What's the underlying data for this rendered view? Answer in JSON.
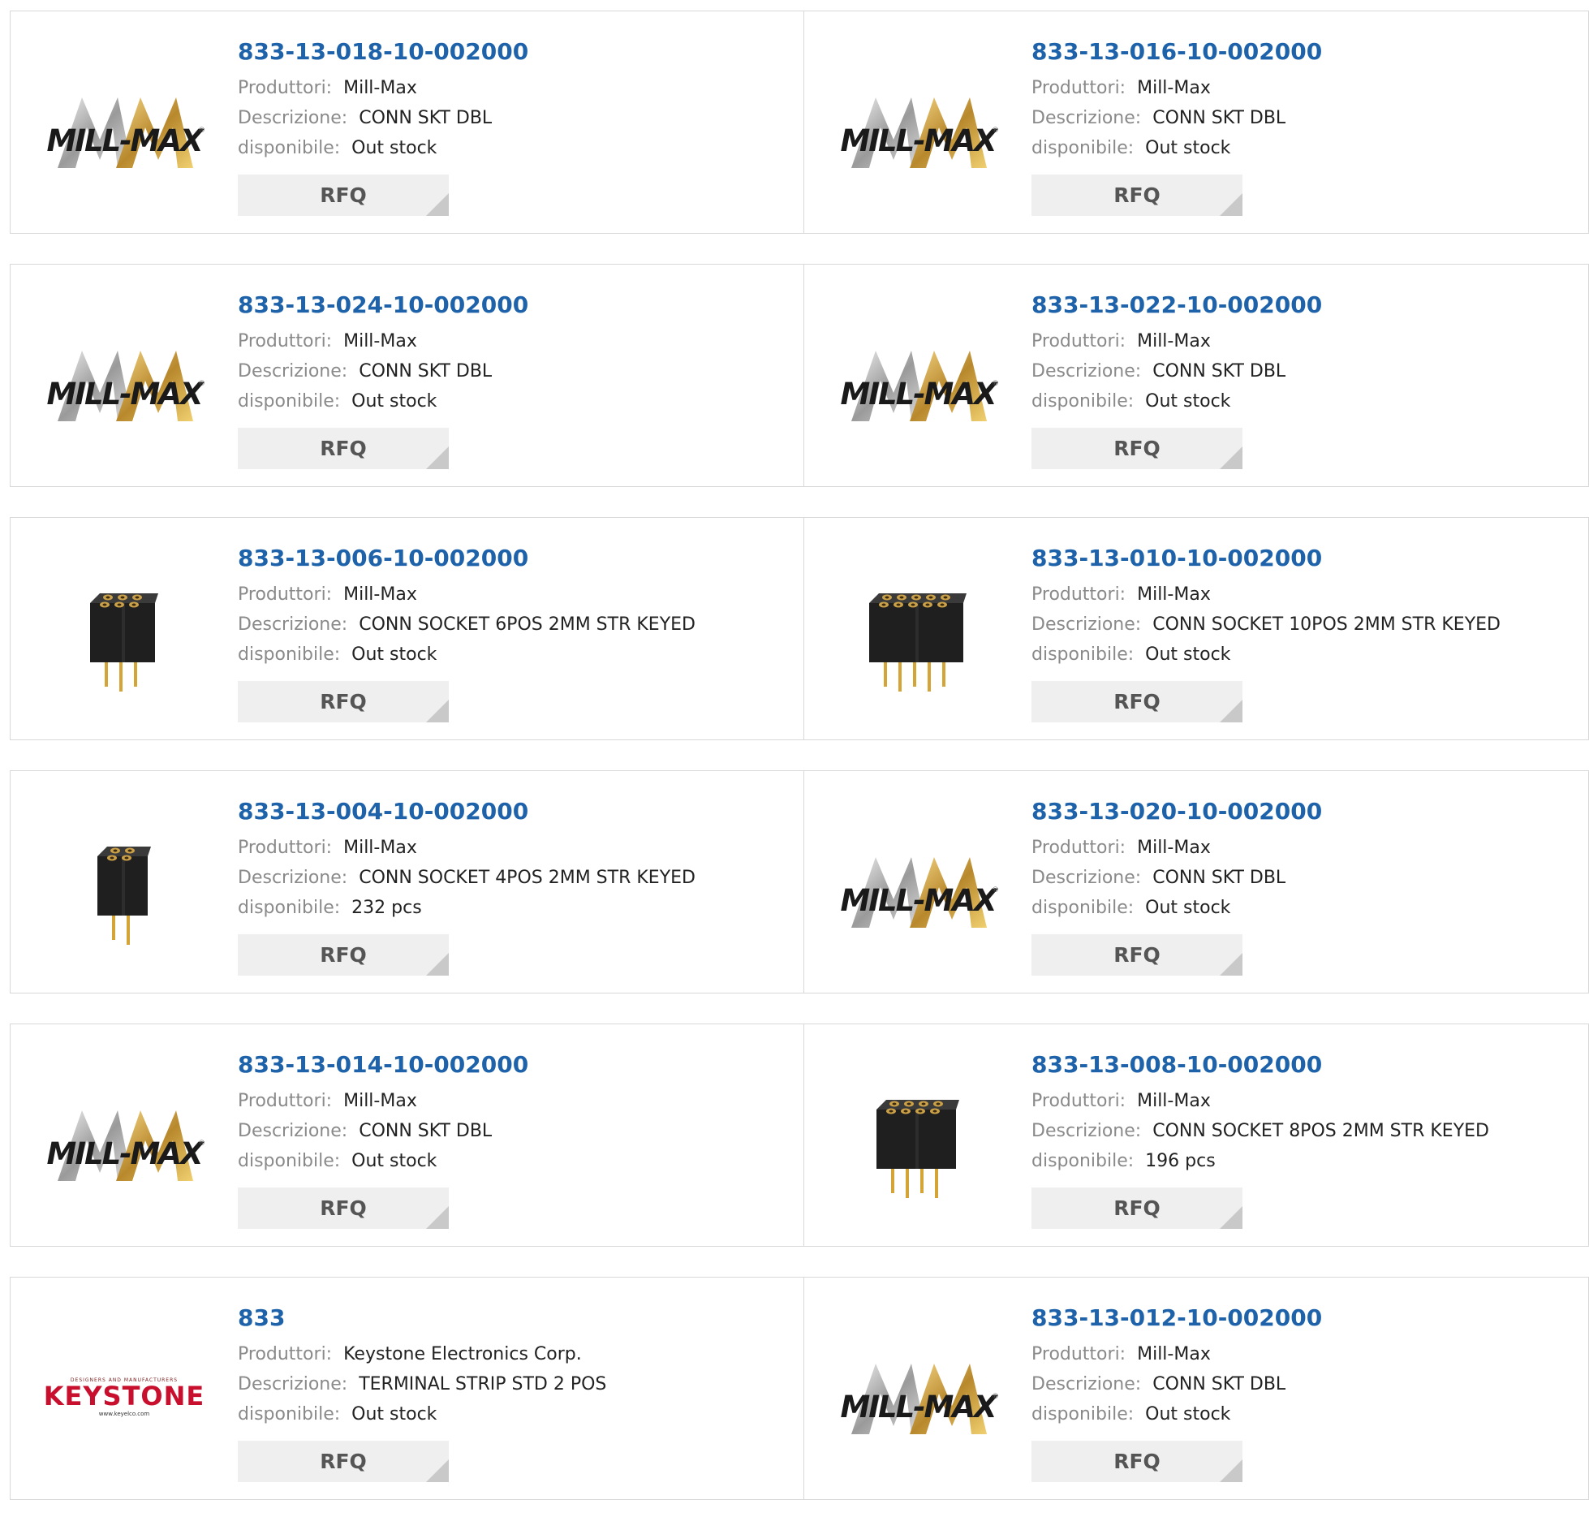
{
  "labels": {
    "manufacturer": "Produttori:",
    "description": "Descrizione:",
    "availability": "disponibile:",
    "rfq": "RFQ"
  },
  "logos": {
    "millmax": "MILL-MAX",
    "millmax_reg": "®",
    "keystone_top": "DESIGNERS AND MANUFACTURERS",
    "keystone": "KEYSTONE",
    "keystone_url": "www.keyelco.com"
  },
  "products": [
    {
      "pn": "833-13-018-10-002000",
      "manufacturer": "Mill-Max",
      "description": "CONN SKT DBL",
      "availability": "Out stock",
      "image": "millmax-logo"
    },
    {
      "pn": "833-13-016-10-002000",
      "manufacturer": "Mill-Max",
      "description": "CONN SKT DBL",
      "availability": "Out stock",
      "image": "millmax-logo"
    },
    {
      "pn": "833-13-024-10-002000",
      "manufacturer": "Mill-Max",
      "description": "CONN SKT DBL",
      "availability": "Out stock",
      "image": "millmax-logo"
    },
    {
      "pn": "833-13-022-10-002000",
      "manufacturer": "Mill-Max",
      "description": "CONN SKT DBL",
      "availability": "Out stock",
      "image": "millmax-logo"
    },
    {
      "pn": "833-13-006-10-002000",
      "manufacturer": "Mill-Max",
      "description": "CONN SOCKET 6POS 2MM STR KEYED",
      "availability": "Out stock",
      "image": "socket-6pos"
    },
    {
      "pn": "833-13-010-10-002000",
      "manufacturer": "Mill-Max",
      "description": "CONN SOCKET 10POS 2MM STR KEYED",
      "availability": "Out stock",
      "image": "socket-10pos"
    },
    {
      "pn": "833-13-004-10-002000",
      "manufacturer": "Mill-Max",
      "description": "CONN SOCKET 4POS 2MM STR KEYED",
      "availability": "232 pcs",
      "image": "socket-4pos"
    },
    {
      "pn": "833-13-020-10-002000",
      "manufacturer": "Mill-Max",
      "description": "CONN SKT DBL",
      "availability": "Out stock",
      "image": "millmax-logo"
    },
    {
      "pn": "833-13-014-10-002000",
      "manufacturer": "Mill-Max",
      "description": "CONN SKT DBL",
      "availability": "Out stock",
      "image": "millmax-logo"
    },
    {
      "pn": "833-13-008-10-002000",
      "manufacturer": "Mill-Max",
      "description": "CONN SOCKET 8POS 2MM STR KEYED",
      "availability": "196 pcs",
      "image": "socket-8pos"
    },
    {
      "pn": "833",
      "manufacturer": "Keystone Electronics Corp.",
      "description": "TERMINAL STRIP STD 2 POS",
      "availability": "Out stock",
      "image": "keystone-logo"
    },
    {
      "pn": "833-13-012-10-002000",
      "manufacturer": "Mill-Max",
      "description": "CONN SKT DBL",
      "availability": "Out stock",
      "image": "millmax-logo"
    }
  ],
  "colors": {
    "link": "#1e62aa",
    "label": "#8a8a8a",
    "border": "#d8d8d8",
    "rfq_bg": "#efefef",
    "keystone_red": "#c8102e"
  }
}
